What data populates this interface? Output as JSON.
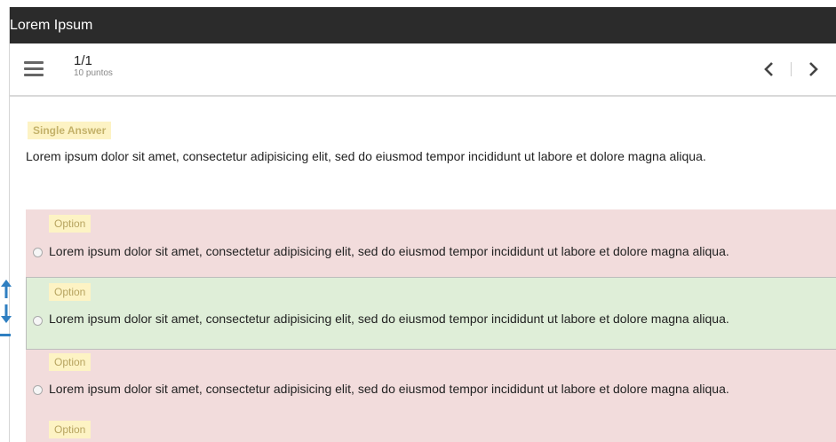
{
  "app": {
    "title": "Lorem Ipsum"
  },
  "toolbar": {
    "counter": "1/1",
    "points": "10 puntos"
  },
  "question": {
    "type_label": "Single Answer",
    "text": "Lorem ipsum dolor sit amet, consectetur adipisicing elit, sed do eiusmod tempor incididunt ut labore et dolore magna aliqua."
  },
  "options": [
    {
      "tag": "Option",
      "text": "Lorem ipsum dolor sit amet, consectetur adipisicing elit, sed do eiusmod tempor incididunt ut labore et dolore magna aliqua.",
      "state": "incorrect"
    },
    {
      "tag": "Option",
      "text": "Lorem ipsum dolor sit amet, consectetur adipisicing elit, sed do eiusmod tempor incididunt ut labore et dolore magna aliqua.",
      "state": "correct"
    },
    {
      "tag": "Option",
      "text": "Lorem ipsum dolor sit amet, consectetur adipisicing elit, sed do eiusmod tempor incididunt ut labore et dolore magna aliqua.",
      "state": "incorrect"
    },
    {
      "tag": "Option",
      "state": "incorrect"
    }
  ],
  "colors": {
    "titlebar": "#2b2b2b",
    "incorrect_bg": "#f2dcdc",
    "correct_bg": "#dfeed8",
    "tag_bg": "#fdf3c4",
    "drag_handle": "#2f7fc1"
  },
  "icons": {
    "menu": "hamburger-icon",
    "prev": "chevron-left-icon",
    "next": "chevron-right-icon",
    "drag": "reorder-arrows-icon"
  }
}
